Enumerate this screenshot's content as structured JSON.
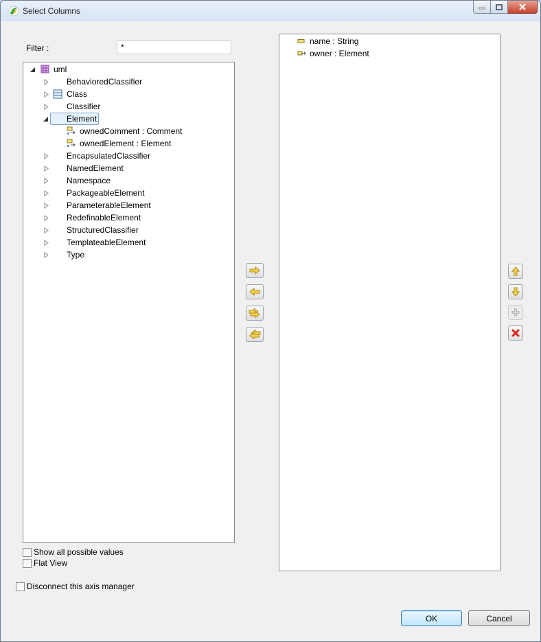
{
  "window": {
    "title": "Select Columns"
  },
  "filter": {
    "label": "Filter :",
    "value": "*"
  },
  "tree": {
    "root": "uml",
    "items": [
      {
        "label": "BehavioredClassifier"
      },
      {
        "label": "Class"
      },
      {
        "label": "Classifier"
      },
      {
        "label": "Element"
      },
      {
        "label": "ownedComment : Comment"
      },
      {
        "label": "ownedElement : Element"
      },
      {
        "label": "EncapsulatedClassifier"
      },
      {
        "label": "NamedElement"
      },
      {
        "label": "Namespace"
      },
      {
        "label": "PackageableElement"
      },
      {
        "label": "ParameterableElement"
      },
      {
        "label": "RedefinableElement"
      },
      {
        "label": "StructuredClassifier"
      },
      {
        "label": "TemplateableElement"
      },
      {
        "label": "Type"
      }
    ]
  },
  "selected_columns": [
    {
      "label": "name : String"
    },
    {
      "label": "owner : Element"
    }
  ],
  "options": {
    "show_all": "Show all possible values",
    "flat_view": "Flat View",
    "disconnect": "Disconnect this axis manager"
  },
  "buttons": {
    "ok": "OK",
    "cancel": "Cancel"
  },
  "colors": {
    "arrow_yellow": "#f5d24a",
    "arrow_border": "#b08a1a",
    "delete_red": "#d8261d",
    "selection_bg": "#e5f1fb"
  }
}
